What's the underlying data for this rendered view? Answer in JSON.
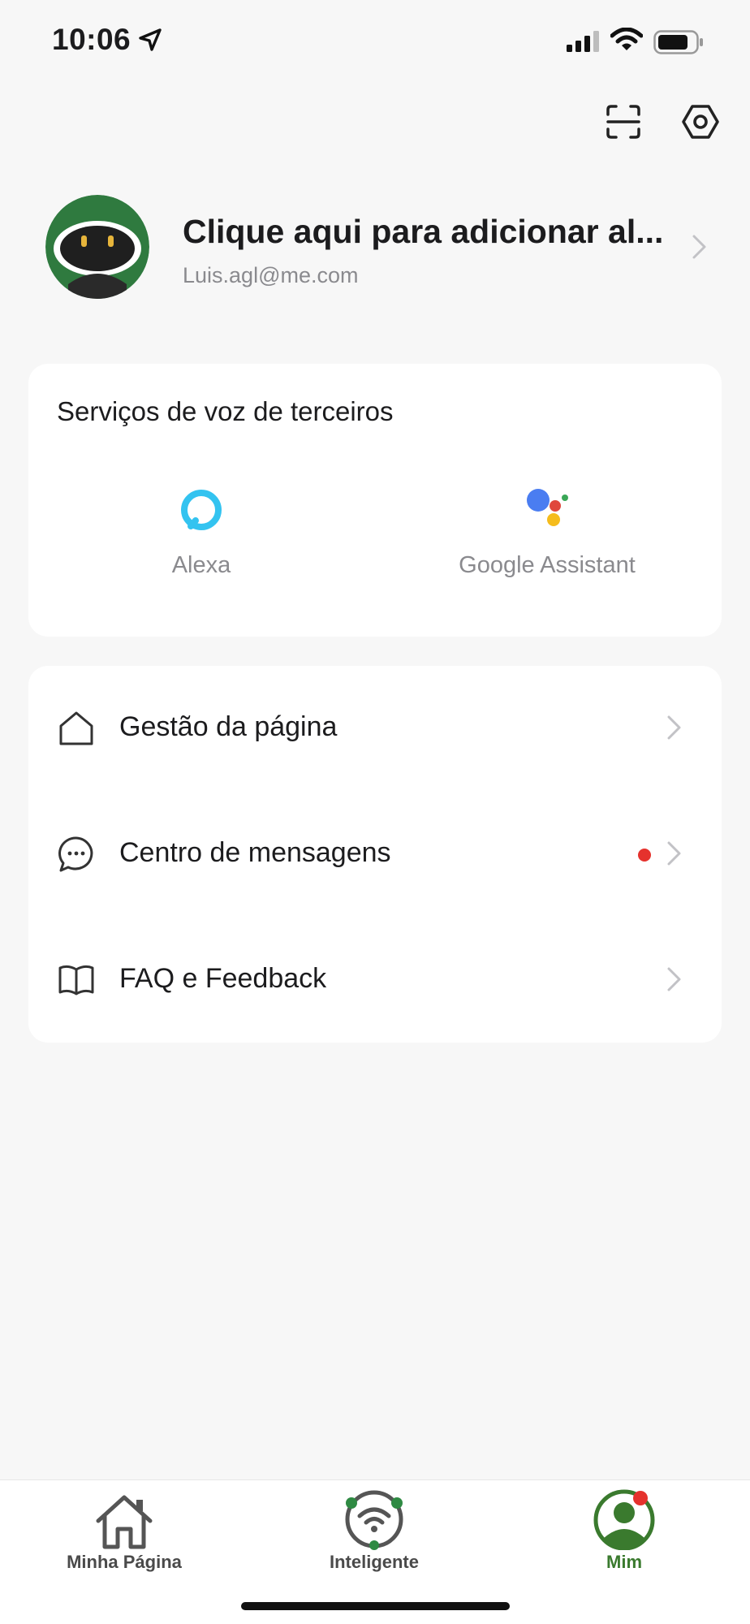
{
  "status_bar": {
    "time": "10:06"
  },
  "top_actions": {
    "scan_icon": "scan-icon",
    "settings_icon": "hexagon-gear-icon"
  },
  "profile": {
    "name": "Clique aqui para adicionar al...",
    "email": "Luis.agl@me.com"
  },
  "voice_services": {
    "title": "Serviços de voz de terceiros",
    "items": [
      {
        "label": "Alexa",
        "icon": "alexa-icon"
      },
      {
        "label": "Google Assistant",
        "icon": "google-assistant-icon"
      }
    ]
  },
  "menu": {
    "items": [
      {
        "label": "Gestão da página",
        "icon": "home-outline-icon",
        "badge": false
      },
      {
        "label": "Centro de mensagens",
        "icon": "message-bubble-icon",
        "badge": true
      },
      {
        "label": "FAQ e Feedback",
        "icon": "open-book-icon",
        "badge": false
      }
    ]
  },
  "tabbar": {
    "tabs": [
      {
        "label": "Minha Página",
        "icon": "home-icon",
        "active": false
      },
      {
        "label": "Inteligente",
        "icon": "smart-wifi-icon",
        "active": false
      },
      {
        "label": "Mim",
        "icon": "profile-icon",
        "active": true
      }
    ]
  },
  "colors": {
    "background": "#f7f7f7",
    "card": "#ffffff",
    "accent_green": "#3a7a2e",
    "badge_red": "#e5322d",
    "secondary_text": "#8a8a8e"
  }
}
